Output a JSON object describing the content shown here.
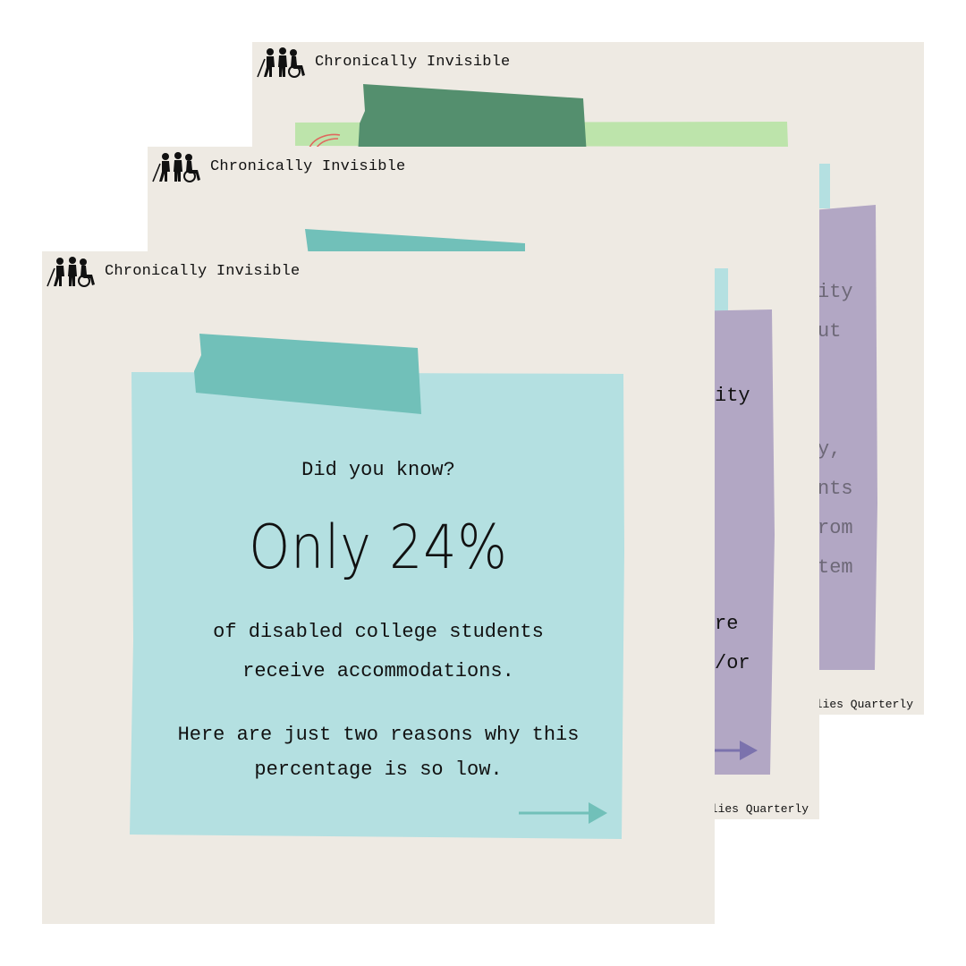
{
  "brand": {
    "name": "Chronically Invisible",
    "logo_icon": "disabled-people-group-icon"
  },
  "colors": {
    "card_background": "#eeeae3",
    "note_light_teal": "#b4e0e1",
    "tape_teal": "#71c0b9",
    "note_purple": "#b2a7c4",
    "arrow_purple": "#7b72ad",
    "tape_green": "#548f6e",
    "note_light_green": "#bde4ab",
    "accent_red": "#e0675e"
  },
  "back_card": {
    "footer": "lies Quarterly",
    "visible_text_lines": [
      "ity",
      "ut",
      "",
      "",
      "y,",
      "nts",
      "rom",
      "tem"
    ]
  },
  "middle_card": {
    "footer": "lies Quarterly",
    "text_line_1": "ity",
    "text_line_2": "re",
    "text_line_3": "/or",
    "arrow_icon": "right-arrow-icon"
  },
  "front_card": {
    "kicker": "Did you know?",
    "headline": "Only 24%",
    "statement_line_1": "of disabled college students",
    "statement_line_2": "receive accommodations.",
    "reason_line_1": "Here are just two reasons why this",
    "reason_line_2": "percentage is so low.",
    "arrow_icon": "right-arrow-icon"
  }
}
